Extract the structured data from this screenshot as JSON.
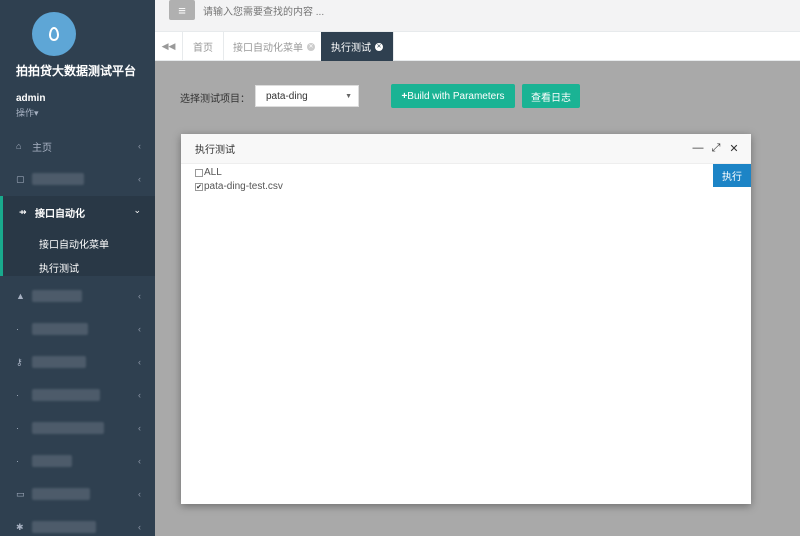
{
  "sidebar": {
    "brand": "拍拍贷大数据测试平台",
    "user": "admin",
    "user_menu": "操作▾",
    "home": "主页",
    "active_section": "接口自动化",
    "sub_items": [
      "接口自动化菜单",
      "执行测试"
    ]
  },
  "topbar": {
    "menu_icon": "≡",
    "search_placeholder": "请输入您需要查找的内容 ..."
  },
  "tabs": {
    "items": [
      {
        "label": "首页"
      },
      {
        "label": "接口自动化菜单"
      },
      {
        "label": "执行测试"
      }
    ],
    "active_index": 2
  },
  "toolbar": {
    "select_label": "选择测试项目：",
    "select_value": "pata-ding",
    "build_button": "Build with Parameters",
    "log_button": "查看日志"
  },
  "modal": {
    "title": "执行测试",
    "checkbox_all": "ALL",
    "checkbox_all_checked": false,
    "checkbox_file": "pata-ding-test.csv",
    "checkbox_file_checked": true,
    "exec_button": "执行"
  },
  "colors": {
    "sidebar_bg": "#2f4050",
    "accent_green": "#1ab394",
    "exec_blue": "#1c84c6"
  }
}
